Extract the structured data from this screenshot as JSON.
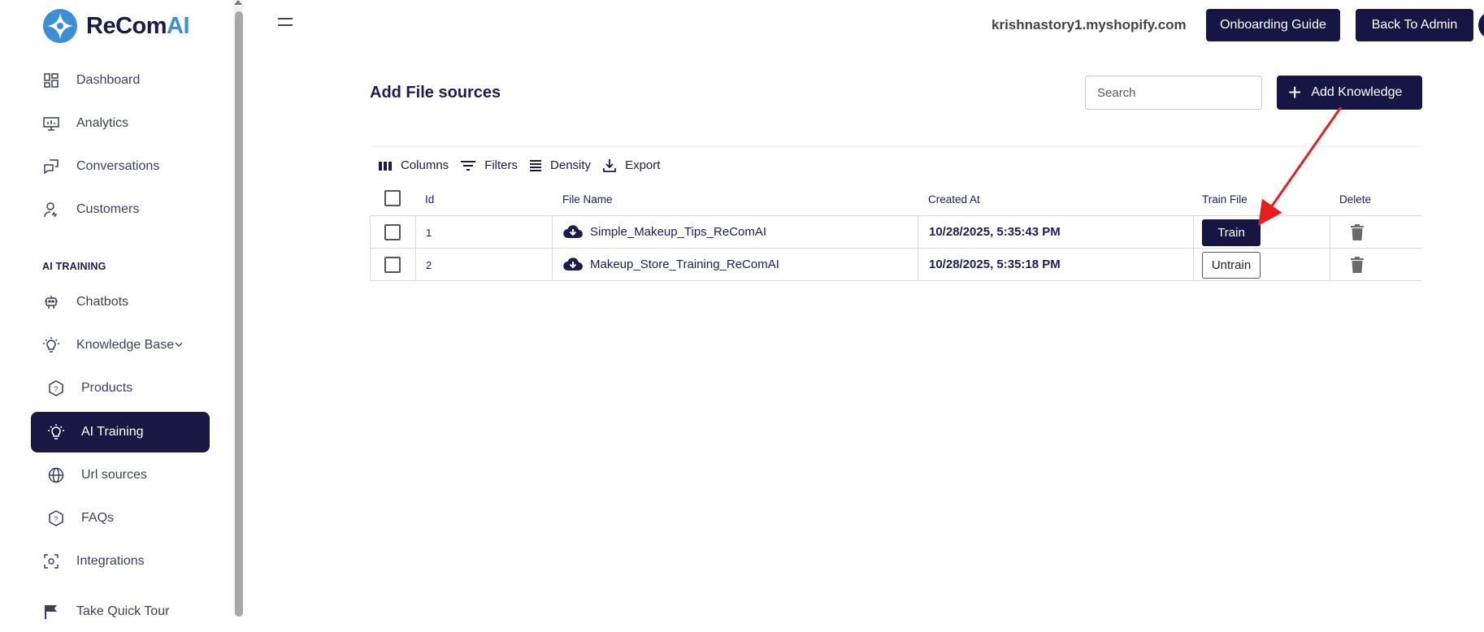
{
  "brand": {
    "name_prefix": "ReCom",
    "name_suffix": "AI",
    "logo_colors": [
      "#3a8fd6",
      "#1b1b4b"
    ]
  },
  "sidebar": {
    "items": [
      {
        "label": "Dashboard",
        "icon": "dashboard-icon"
      },
      {
        "label": "Analytics",
        "icon": "analytics-icon"
      },
      {
        "label": "Conversations",
        "icon": "conversations-icon"
      },
      {
        "label": "Customers",
        "icon": "customers-icon"
      }
    ],
    "section_label": "AI TRAINING",
    "training_items": [
      {
        "label": "Chatbots",
        "icon": "robot-icon"
      },
      {
        "label": "Knowledge Base",
        "icon": "lightbulb-icon"
      },
      {
        "label": "Products",
        "icon": "help-hexagon-icon"
      },
      {
        "label": "AI Training",
        "icon": "lightbulb-icon",
        "active": true
      },
      {
        "label": "Url sources",
        "icon": "globe-icon"
      },
      {
        "label": "FAQs",
        "icon": "help-hexagon-icon"
      },
      {
        "label": "Integrations",
        "icon": "integrations-icon"
      },
      {
        "label": "Take Quick Tour",
        "icon": "flag-icon"
      }
    ]
  },
  "header": {
    "store": "krishnastory1.myshopify.com",
    "onboarding_label": "Onboarding Guide",
    "back_label": "Back To Admin"
  },
  "main": {
    "title": "Add File sources",
    "search_placeholder": "Search",
    "add_label": "Add Knowledge",
    "toolbar": {
      "columns": "Columns",
      "filters": "Filters",
      "density": "Density",
      "export": "Export"
    },
    "table": {
      "headers": {
        "id": "Id",
        "file_name": "File Name",
        "created_at": "Created At",
        "train_file": "Train File",
        "delete": "Delete"
      },
      "rows": [
        {
          "id": "1",
          "file_name": "Simple_Makeup_Tips_ReComAI",
          "created_at": "10/28/2025, 5:35:43 PM",
          "train_label": "Train",
          "train_style": "solid"
        },
        {
          "id": "2",
          "file_name": "Makeup_Store_Training_ReComAI",
          "created_at": "10/28/2025, 5:35:18 PM",
          "train_label": "Untrain",
          "train_style": "outline"
        }
      ]
    }
  },
  "colors": {
    "primary": "#161644",
    "annotation_arrow": "#e81e1e"
  }
}
